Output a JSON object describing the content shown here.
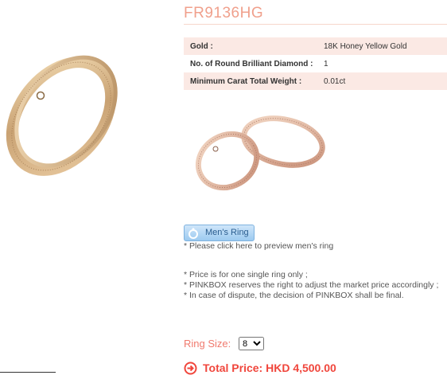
{
  "product": {
    "code": "FR9136HG"
  },
  "specs": [
    {
      "label": "Gold :",
      "value": "18K Honey Yellow Gold"
    },
    {
      "label": "No. of Round Brilliant Diamond :",
      "value": "1"
    },
    {
      "label": "Minimum Carat Total Weight :",
      "value": "0.01ct"
    }
  ],
  "mens_ring": {
    "button_label": "Men's Ring",
    "hint": "* Please click here to preview men's ring"
  },
  "notes": [
    "* Price is for one single ring only ;",
    "* PINKBOX reserves the right to adjust the market price accordingly ;",
    "* In case of dispute, the decision of PINKBOX shall be final."
  ],
  "ring_size": {
    "label": "Ring Size:",
    "selected": "8"
  },
  "price": {
    "total_label": "Total Price: HKD 4,500.00"
  },
  "colors": {
    "accent": "#f0a08c",
    "price": "#f0463c",
    "gold": "#d9b98a"
  }
}
